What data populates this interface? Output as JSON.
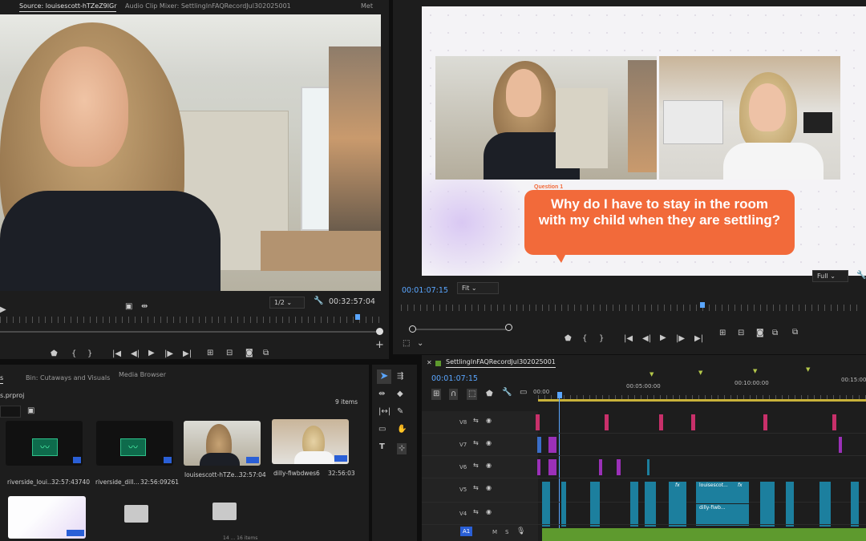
{
  "source_monitor": {
    "tabs": [
      "Source: louisescott-hTZeZ9lGr",
      "Audio Clip Mixer: SettlingInFAQRecordJul302025001",
      "Met"
    ],
    "resolution": "1/2",
    "timecode": "00:32:57:04",
    "icons": [
      "marker-icon",
      "in-point-icon",
      "out-point-icon",
      "step-back-icon",
      "play-icon",
      "step-forward-icon",
      "insert-icon",
      "overwrite-icon",
      "camera-icon",
      "settings-icon",
      "add-icon"
    ]
  },
  "program_monitor": {
    "timecode": "00:01:07:15",
    "fit": "Fit",
    "quality": "Full",
    "graphic": {
      "label": "Question 1",
      "question": "Why do I have to stay in the room with my child when they are settling?"
    }
  },
  "project_panel": {
    "tabs": [
      "s",
      "Bin: Cutaways and Visuals",
      "Media Browser"
    ],
    "project_file": "s.prproj",
    "item_count": "9 items",
    "items": [
      {
        "name": "riverside_loui...",
        "duration": "32:57:43740",
        "kind": "audio"
      },
      {
        "name": "riverside_dill...",
        "duration": "32:56:09261",
        "kind": "audio"
      },
      {
        "name": "louisescott-hTZe...",
        "duration": "32:57:04",
        "kind": "video-louise"
      },
      {
        "name": "dilly-fiwbdwes6",
        "duration": "32:56:03",
        "kind": "video-dilly"
      },
      {
        "name": "",
        "duration": "",
        "kind": "graphic"
      },
      {
        "name": "",
        "duration": "",
        "kind": "folder"
      },
      {
        "name": "",
        "duration": "",
        "kind": "folder"
      }
    ],
    "footer": "14 ... 16 items"
  },
  "tools": [
    "selection-tool",
    "track-select-tool",
    "ripple-edit-tool",
    "razor-tool",
    "slip-tool",
    "pen-tool",
    "rectangle-tool",
    "hand-tool",
    "type-tool",
    "generate-tool"
  ],
  "timeline": {
    "sequence_name": "SettlingInFAQRecordJul302025001",
    "timecode": "00:01:07:15",
    "ruler": [
      "00:00",
      "00:05:00:00",
      "00:10:00:00",
      "00:15:00"
    ],
    "tracks": [
      "V8",
      "V7",
      "V6",
      "V5",
      "V4",
      "A1"
    ],
    "audio_buttons": [
      "M",
      "S"
    ],
    "clip_labels": [
      "louisescot...",
      "dilly-fiwb...",
      "fx"
    ]
  },
  "colors": {
    "accent_blue": "#5aa6ff",
    "clip_magenta": "#c8306a",
    "clip_purple": "#9b30b8",
    "clip_teal": "#1c7f9e",
    "clip_green": "#5e9a2e",
    "speech_orange": "#f26a3a"
  }
}
